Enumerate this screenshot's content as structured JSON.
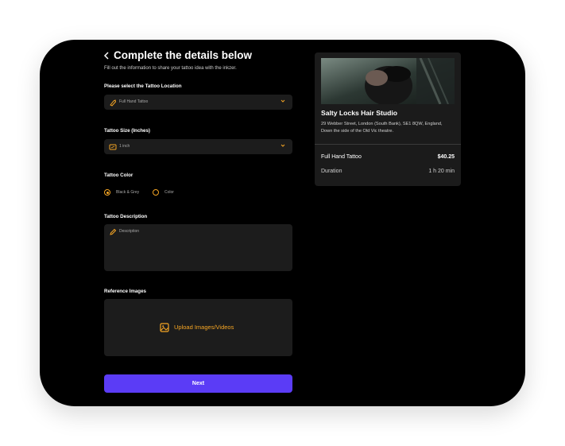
{
  "header": {
    "back_icon": "chevron-left-icon",
    "title": "Complete the details below",
    "subtitle": "Fill out the information to share your tattoo idea with the inkzer."
  },
  "location": {
    "label": "Please select the Tattoo Location",
    "value": "Full Hand Tattoo",
    "icon": "arm-icon"
  },
  "size": {
    "label": "Tattoo Size (Inches)",
    "value": "1 inch",
    "icon": "ruler-frame-icon"
  },
  "color": {
    "label": "Tattoo Color",
    "options": [
      "Black & Grey",
      "Color"
    ],
    "selected": "Black & Grey"
  },
  "description": {
    "label": "Tattoo Description",
    "placeholder": "Description",
    "icon": "pencil-icon"
  },
  "reference": {
    "label": "Reference Images",
    "upload_text": "Upload Images/Videos",
    "icon": "image-icon"
  },
  "next_label": "Next",
  "summary": {
    "studio_name": "Salty Locks Hair Studio",
    "address": "29 Webber Street, London (South Bank), SE1 8QW, England, Down the side of the Old Vic theatre.",
    "service": "Full Hand Tattoo",
    "price": "$40.25",
    "duration_label": "Duration",
    "duration_value": "1 h 20 min"
  },
  "colors": {
    "accent": "#f5a524",
    "primary": "#5b3cf6",
    "background": "#000000",
    "field": "#1c1c1c"
  }
}
